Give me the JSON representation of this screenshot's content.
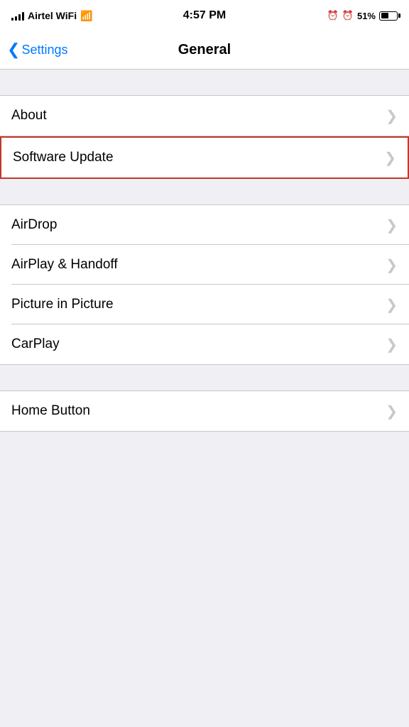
{
  "statusBar": {
    "carrier": "Airtel WiFi",
    "time": "4:57 PM",
    "alarm_icon": "⏰",
    "battery_pct": "51%"
  },
  "navBar": {
    "back_label": "Settings",
    "title": "General"
  },
  "sections": [
    {
      "id": "section1",
      "rows": [
        {
          "id": "about",
          "label": "About",
          "highlighted": false
        }
      ]
    },
    {
      "id": "section2",
      "rows": [
        {
          "id": "software-update",
          "label": "Software Update",
          "highlighted": true
        }
      ]
    },
    {
      "id": "section3",
      "rows": [
        {
          "id": "airdrop",
          "label": "AirDrop",
          "highlighted": false
        },
        {
          "id": "airplay-handoff",
          "label": "AirPlay & Handoff",
          "highlighted": false
        },
        {
          "id": "picture-in-picture",
          "label": "Picture in Picture",
          "highlighted": false
        },
        {
          "id": "carplay",
          "label": "CarPlay",
          "highlighted": false
        }
      ]
    },
    {
      "id": "section4",
      "rows": [
        {
          "id": "home-button",
          "label": "Home Button",
          "highlighted": false
        }
      ]
    }
  ],
  "chevron": "❯"
}
